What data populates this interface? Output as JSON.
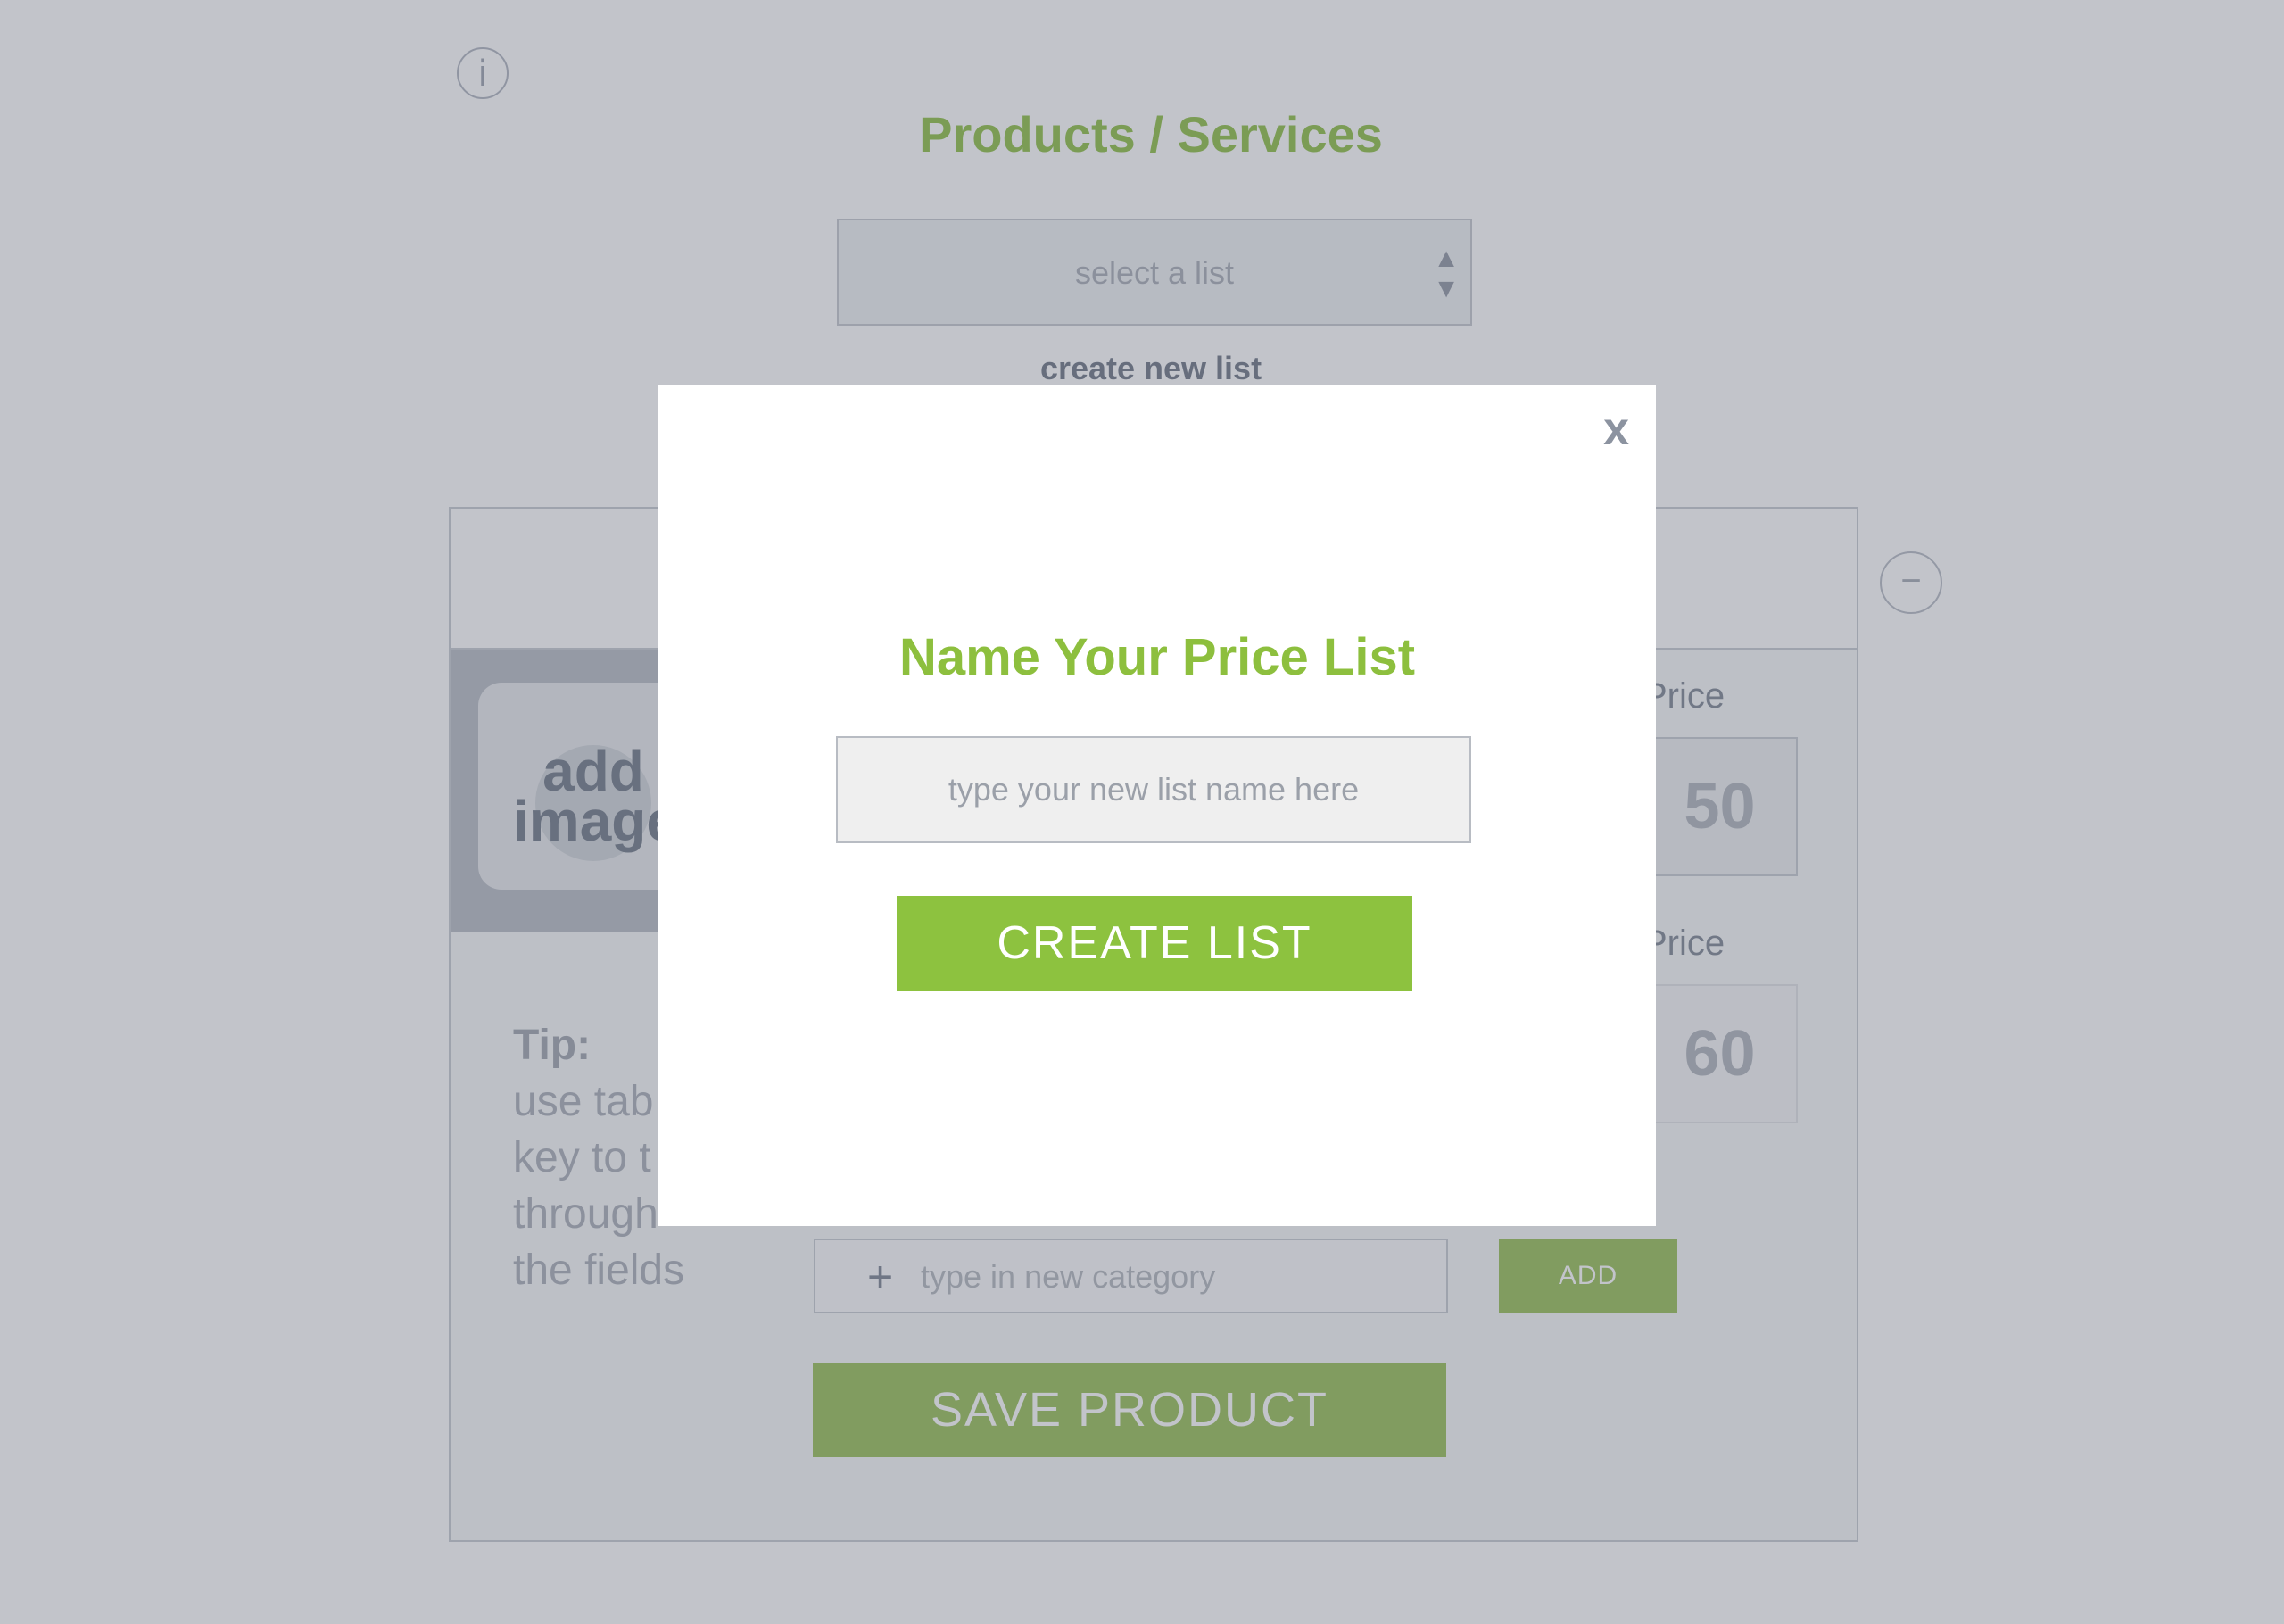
{
  "page": {
    "title": "Products / Services",
    "list_select": {
      "placeholder": "select a list"
    },
    "create_list_link": "create new list",
    "product_form": {
      "image_label": "add image",
      "tip_heading": "Tip:",
      "tip_lines": [
        "use tab",
        "key to t",
        "through",
        "the fields"
      ],
      "price_label_1": "Price",
      "price_value_1": "50",
      "price_label_2": "Price",
      "price_value_2": "60",
      "category_input": {
        "placeholder": "type in new category",
        "icon": "plus-icon"
      },
      "add_button": "ADD",
      "save_button": "SAVE PRODUCT"
    }
  },
  "modal": {
    "close_label": "x",
    "title": "Name Your Price List",
    "name_input": {
      "placeholder": "type your new list name here",
      "value": ""
    },
    "create_button": "CREATE LIST"
  },
  "colors": {
    "accent_green": "#8dc23f",
    "overlay": "rgba(95,100,115,0.38)",
    "muted_text": "#9ba0a9"
  }
}
